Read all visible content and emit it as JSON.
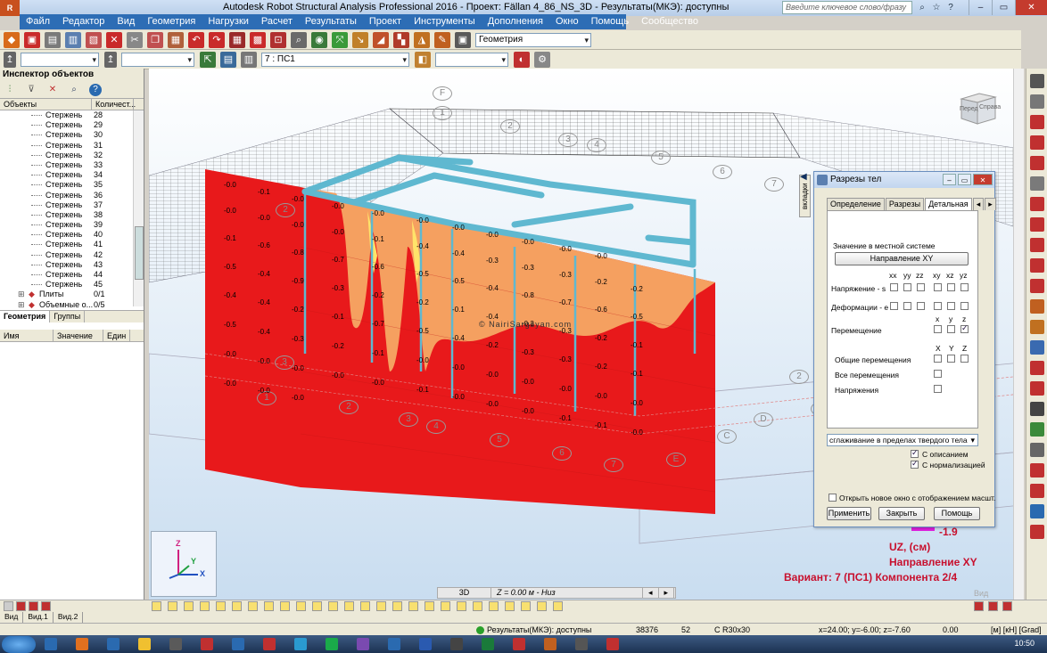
{
  "titlebar": {
    "logo": "R",
    "title": "Autodesk Robot Structural Analysis Professional 2016 - Проект: Fällan 4_86_NS_3D - Результаты(МКЭ): доступны",
    "search_placeholder": "Введите ключевое слово/фразу"
  },
  "menu": [
    "Файл",
    "Редактор",
    "Вид",
    "Геометрия",
    "Нагрузки",
    "Расчет",
    "Результаты",
    "Проект",
    "Инструменты",
    "Дополнения",
    "Окно",
    "Помощь",
    "Сообщество"
  ],
  "toolbar1": {
    "layout_combo": "Геометрия"
  },
  "toolbar2": {
    "case_combo": "7 : ПС1"
  },
  "inspector": {
    "title": "Инспектор объектов",
    "col_objects": "Объекты",
    "col_count": "Количест...",
    "rows": [
      {
        "name": "Стержень",
        "count": "28"
      },
      {
        "name": "Стержень",
        "count": "29"
      },
      {
        "name": "Стержень",
        "count": "30"
      },
      {
        "name": "Стержень",
        "count": "31"
      },
      {
        "name": "Стержень",
        "count": "32"
      },
      {
        "name": "Стержень",
        "count": "33"
      },
      {
        "name": "Стержень",
        "count": "34"
      },
      {
        "name": "Стержень",
        "count": "35"
      },
      {
        "name": "Стержень",
        "count": "36"
      },
      {
        "name": "Стержень",
        "count": "37"
      },
      {
        "name": "Стержень",
        "count": "38"
      },
      {
        "name": "Стержень",
        "count": "39"
      },
      {
        "name": "Стержень",
        "count": "40"
      },
      {
        "name": "Стержень",
        "count": "41"
      },
      {
        "name": "Стержень",
        "count": "42"
      },
      {
        "name": "Стержень",
        "count": "43"
      },
      {
        "name": "Стержень",
        "count": "44"
      },
      {
        "name": "Стержень",
        "count": "45"
      }
    ],
    "groups": [
      {
        "name": "Плиты",
        "count": "0/1"
      },
      {
        "name": "Объемные о...",
        "count": "0/5"
      }
    ],
    "tabs": [
      "Геометрия",
      "Группы"
    ],
    "prop_cols": [
      "Имя",
      "Значение",
      "Един"
    ]
  },
  "viewport": {
    "watermark": "© NairiSargsyan.com",
    "cube_front": "Перед",
    "cube_right": "Справа",
    "axis_x": "X",
    "axis_y": "Y",
    "axis_z": "Z",
    "view_label": "Вид",
    "legend_value": "-1.9",
    "result_lines": [
      "UZ, (см)",
      "Направление XY",
      "Вариант: 7 (ПС1) Компонента 2/4"
    ],
    "grid_labels": [
      "F",
      "1",
      "2",
      "3",
      "4",
      "5",
      "6",
      "7",
      "2",
      "3",
      "1",
      "2",
      "3",
      "4",
      "5",
      "6",
      "7",
      "E",
      "2",
      "D",
      "C",
      "F"
    ],
    "contour_values": [
      "-0.0",
      "-0.1",
      "-0.0",
      "-0.0",
      "-0.0",
      "-0.0",
      "-0.0",
      "-0.0",
      "-0.0",
      "-0.0",
      "-0.0",
      "-0.0",
      "-0.0",
      "-0.0",
      "-0.0",
      "-0.1",
      "-0.4",
      "-0.4",
      "-0.3",
      "-0.3",
      "-0.3",
      "-0.2",
      "-0.2",
      "-0.1",
      "-0.6",
      "-0.8",
      "-0.7",
      "-0.6",
      "-0.5",
      "-0.5",
      "-0.4",
      "-0.8",
      "-0.7",
      "-0.6",
      "-0.5",
      "-0.5",
      "-0.4",
      "-0.9",
      "-0.3",
      "-0.2",
      "-0.2",
      "-0.1",
      "-0.4",
      "-0.3",
      "-0.3",
      "-0.2",
      "-0.1",
      "-0.4",
      "-0.4",
      "-0.2",
      "-0.1",
      "-0.7",
      "-0.5",
      "-0.4",
      "-0.2",
      "-0.3",
      "-0.3",
      "-0.2",
      "-0.1",
      "-0.5",
      "-0.4",
      "-0.3",
      "-0.2",
      "-0.1",
      "-0.0",
      "-0.0",
      "-0.0",
      "-0.0",
      "-0.0",
      "-0.0",
      "-0.0",
      "-0.0",
      "-0.0",
      "-0.0",
      "-0.0",
      "-0.0",
      "-0.1",
      "-0.0",
      "-0.0",
      "-0.0",
      "-0.1",
      "-0.1",
      "-0.0",
      "-0.0",
      "-0.0",
      "-0.0"
    ]
  },
  "dialog": {
    "title": "Разрезы тел",
    "side_tab": "вкладки",
    "tabs": [
      "Определение",
      "Разрезы",
      "Детальная"
    ],
    "local_system_label": "Значение в местной системе",
    "direction_button": "Направление XY",
    "col_xx": "xx",
    "col_yy": "yy",
    "col_zz": "zz",
    "col_xy": "xy",
    "col_xz": "xz",
    "col_yz": "yz",
    "col_x": "x",
    "col_y": "y",
    "col_z": "z",
    "col_X": "X",
    "col_Y": "Y",
    "col_Z": "Z",
    "stress_label": "Напряжение - s",
    "strain_label": "Деформации - e",
    "displacement_label": "Перемещение",
    "general_disp_label": "Общие перемещения",
    "all_disp_label": "Все перемещения",
    "stresses_label": "Напряжения",
    "smoothing_select": "сглаживание в пределах твердого тела",
    "with_description": "С описанием",
    "with_normalization": "С нормализацией",
    "open_new_window": "Открыть новое окно с отображением масшт.",
    "apply": "Применить",
    "close": "Закрыть",
    "help": "Помощь"
  },
  "viewbar": {
    "mode": "3D",
    "level": "Z = 0.00 м - Низ"
  },
  "viewtabs": [
    "Вид",
    "Вид.1",
    "Вид.2"
  ],
  "status": {
    "results": "Результаты(МКЭ): доступны",
    "num1": "38376",
    "num2": "52",
    "section": "С R30x30",
    "coords": "x=24.00; y=-6.00; z=-7.60",
    "value": "0.00",
    "units": "[м] [кН] [Grad]"
  },
  "taskbar": {
    "clock": "10:50"
  },
  "colors": {
    "red_region": "#e8191b",
    "orange_region": "#f5a060",
    "beam": "#5fb8d0",
    "result_text": "#c8102e"
  }
}
